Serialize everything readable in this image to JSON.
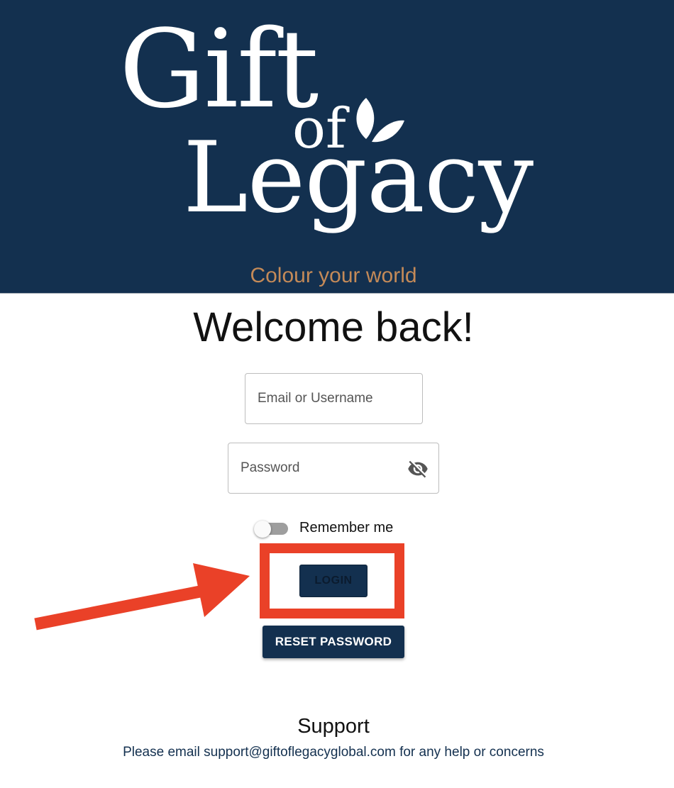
{
  "header": {
    "logo_line1": "Gift",
    "logo_line2": "of",
    "logo_line3": "Legacy",
    "tagline": "Colour your world",
    "background_color": "#13304f",
    "tagline_color": "#c48a58"
  },
  "login_form": {
    "title": "Welcome back!",
    "email_placeholder": "Email or Username",
    "email_value": "",
    "password_placeholder": "Password",
    "password_value": "",
    "password_visibility_icon": "eye-off-icon",
    "remember_me_label": "Remember me",
    "remember_me_checked": false,
    "login_label": "LOGIN",
    "reset_password_label": "RESET PASSWORD",
    "button_color": "#13304f"
  },
  "annotation": {
    "highlight_color": "#ea4128",
    "arrow_color": "#ea4128"
  },
  "support": {
    "title": "Support",
    "message": "Please email support@giftoflegacyglobal.com for any help or concerns"
  }
}
